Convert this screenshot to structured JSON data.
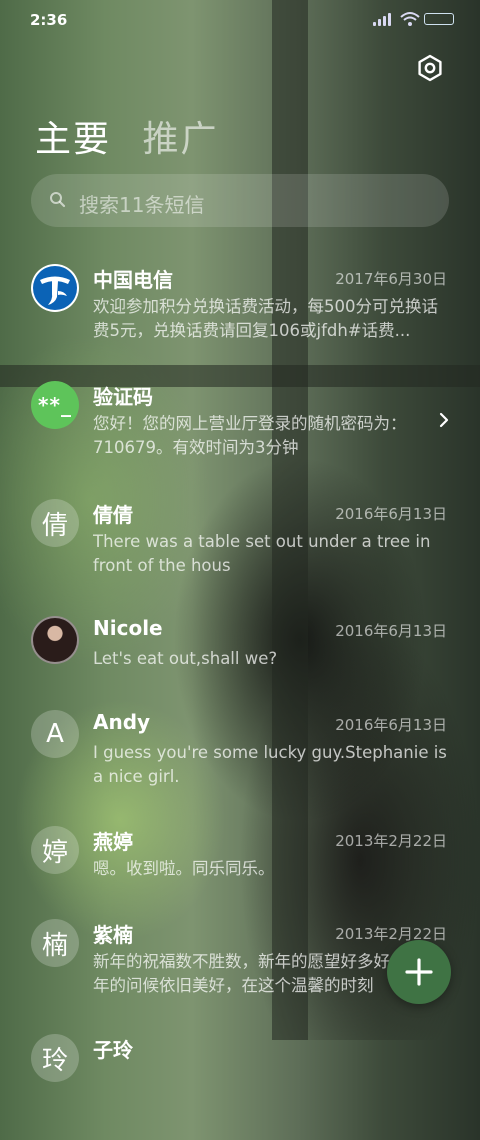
{
  "status_bar": {
    "time": "2:36"
  },
  "tabs": [
    {
      "label": "主要",
      "active": true
    },
    {
      "label": "推广",
      "active": false
    }
  ],
  "search": {
    "placeholder": "搜索11条短信"
  },
  "conversations": [
    {
      "name": "中国电信",
      "date": "2017年6月30日",
      "preview": "欢迎参加积分兑换话费活动，每500分可兑换话费5元，兑换话费请回复106或jfdh#话费...",
      "avatar": "telecom-logo"
    },
    {
      "name": "验证码",
      "date": "",
      "preview": "您好！您的网上营业厅登录的随机密码为：710679。有效时间为3分钟",
      "avatar_text": "**_",
      "avatar": "code"
    },
    {
      "name": "倩倩",
      "date": "2016年6月13日",
      "preview": "There was a table set out under a tree in front of the hous",
      "avatar_text": "倩",
      "avatar": "initial"
    },
    {
      "name": "Nicole",
      "date": "2016年6月13日",
      "preview": "Let's eat out,shall we?",
      "avatar": "photo"
    },
    {
      "name": "Andy",
      "date": "2016年6月13日",
      "preview": "I guess you're some lucky guy.Stephanie is a nice girl.",
      "avatar_text": "A",
      "avatar": "initial"
    },
    {
      "name": "燕婷",
      "date": "2013年2月22日",
      "preview": "嗯。收到啦。同乐同乐。",
      "avatar_text": "婷",
      "avatar": "initial"
    },
    {
      "name": "紫楠",
      "date": "2013年2月22日",
      "preview": "新年的祝福数不胜数，新年的愿望好多好多，新年的问候依旧美好，在这个温馨的时刻",
      "avatar_text": "楠",
      "avatar": "initial"
    },
    {
      "name": "子玲",
      "date": "",
      "preview": "",
      "avatar_text": "玲",
      "avatar": "initial"
    }
  ],
  "colors": {
    "fab": "#3f7344",
    "code_avatar": "#5ec45a",
    "telecom_blue": "#0b63b6"
  }
}
